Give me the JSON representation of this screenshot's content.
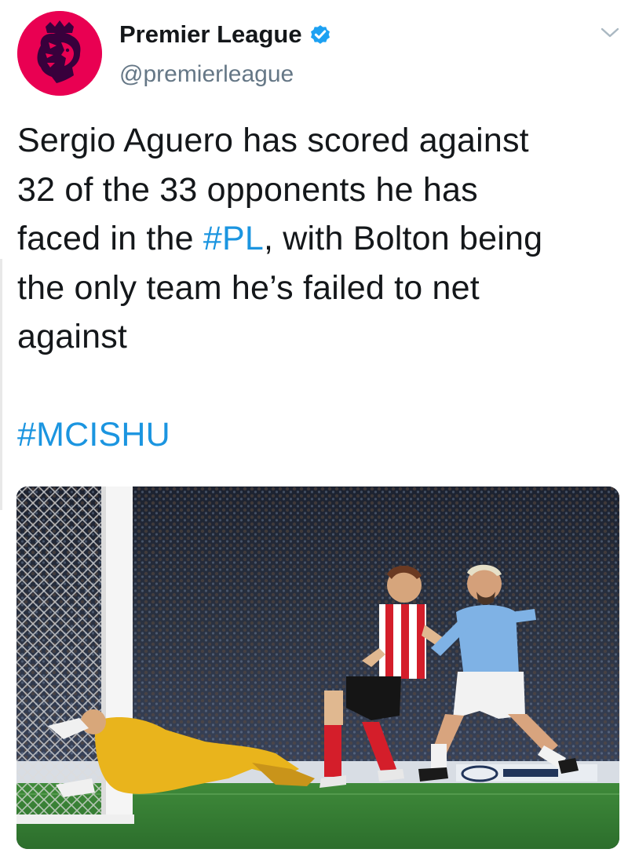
{
  "account": {
    "display_name": "Premier League",
    "handle": "@premierleague",
    "verified": true,
    "avatar_color": "#e90052"
  },
  "tweet": {
    "line1": "Sergio Aguero has scored against",
    "line2": "32 of the 33 opponents he has",
    "line3_before": "faced in the ",
    "line3_hashtag": "#PL",
    "line3_after": ", with Bolton being",
    "line4": "the only team he’s failed to net",
    "line5": "against",
    "hashtag_line": "#MCISHU"
  },
  "media": {
    "kind": "photo",
    "icon": "football-photo"
  },
  "icons": {
    "verified": "verified-badge-icon",
    "caret": "chevron-down-icon",
    "avatar": "premier-league-lion-logo"
  },
  "colors": {
    "text": "#14171a",
    "secondary": "#657786",
    "link": "#1b95e0",
    "verified": "#1da1f2"
  }
}
